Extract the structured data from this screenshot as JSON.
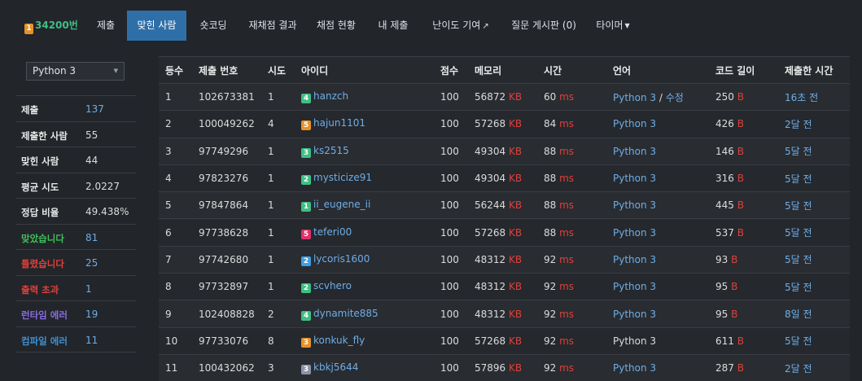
{
  "nav": {
    "problem_id": "34200번",
    "tabs": [
      "제출",
      "맞힌 사람",
      "숏코딩",
      "재채점 결과",
      "채점 현황",
      "내 제출",
      "난이도 기여",
      "질문 게시판 (0)",
      "타이머"
    ]
  },
  "sidebar": {
    "language": "Python 3",
    "stats": [
      {
        "label": "제출",
        "value": "137",
        "color": "#e8e8e8",
        "vcolor": "#6eaee8"
      },
      {
        "label": "제출한 사람",
        "value": "55",
        "color": "#e8e8e8",
        "vcolor": "#dcdcdc"
      },
      {
        "label": "맞힌 사람",
        "value": "44",
        "color": "#e8e8e8",
        "vcolor": "#dcdcdc"
      },
      {
        "label": "평균 시도",
        "value": "2.0227",
        "color": "#e8e8e8",
        "vcolor": "#dcdcdc"
      },
      {
        "label": "정답 비율",
        "value": "49.438%",
        "color": "#e8e8e8",
        "vcolor": "#dcdcdc"
      },
      {
        "label": "맞았습니다",
        "value": "81",
        "color": "#3fbf5c",
        "vcolor": "#6eaee8"
      },
      {
        "label": "틀렸습니다",
        "value": "25",
        "color": "#e0403a",
        "vcolor": "#6eaee8"
      },
      {
        "label": "출력 초과",
        "value": "1",
        "color": "#e0403a",
        "vcolor": "#6eaee8"
      },
      {
        "label": "런타임 에러",
        "value": "19",
        "color": "#8a6ce0",
        "vcolor": "#6eaee8"
      },
      {
        "label": "컴파일 에러",
        "value": "11",
        "color": "#3f8fd0",
        "vcolor": "#6eaee8"
      }
    ]
  },
  "table": {
    "headers": [
      "등수",
      "제출 번호",
      "시도",
      "아이디",
      "점수",
      "메모리",
      "시간",
      "언어",
      "코드 길이",
      "제출한 시간"
    ],
    "rows": [
      {
        "rank": "1",
        "sub": "102673381",
        "tries": "1",
        "tier": "4",
        "tcolor": "#3fbf84",
        "user": "hanzch",
        "score": "100",
        "mem": "56872",
        "mem_unit": "KB",
        "time": "60",
        "time_unit": "ms",
        "lang": "Python 3",
        "edit": "수정",
        "len": "250",
        "len_unit": "B",
        "when": "16초 전",
        "lang_link": true
      },
      {
        "rank": "2",
        "sub": "100049262",
        "tries": "4",
        "tier": "5",
        "tcolor": "#e8922a",
        "user": "hajun1101",
        "score": "100",
        "mem": "57268",
        "mem_unit": "KB",
        "time": "84",
        "time_unit": "ms",
        "lang": "Python 3",
        "edit": "",
        "len": "426",
        "len_unit": "B",
        "when": "2달 전",
        "lang_link": true
      },
      {
        "rank": "3",
        "sub": "97749296",
        "tries": "1",
        "tier": "3",
        "tcolor": "#3fbf84",
        "user": "ks2515",
        "score": "100",
        "mem": "49304",
        "mem_unit": "KB",
        "time": "88",
        "time_unit": "ms",
        "lang": "Python 3",
        "edit": "",
        "len": "146",
        "len_unit": "B",
        "when": "5달 전",
        "lang_link": true
      },
      {
        "rank": "4",
        "sub": "97823276",
        "tries": "1",
        "tier": "2",
        "tcolor": "#3fbf84",
        "user": "mysticize91",
        "score": "100",
        "mem": "49304",
        "mem_unit": "KB",
        "time": "88",
        "time_unit": "ms",
        "lang": "Python 3",
        "edit": "",
        "len": "316",
        "len_unit": "B",
        "when": "5달 전",
        "lang_link": true
      },
      {
        "rank": "5",
        "sub": "97847864",
        "tries": "1",
        "tier": "1",
        "tcolor": "#3fbf84",
        "user": "ii_eugene_ii",
        "score": "100",
        "mem": "56244",
        "mem_unit": "KB",
        "time": "88",
        "time_unit": "ms",
        "lang": "Python 3",
        "edit": "",
        "len": "445",
        "len_unit": "B",
        "when": "5달 전",
        "lang_link": true
      },
      {
        "rank": "6",
        "sub": "97738628",
        "tries": "1",
        "tier": "5",
        "tcolor": "#e0306a",
        "user": "teferi00",
        "score": "100",
        "mem": "57268",
        "mem_unit": "KB",
        "time": "88",
        "time_unit": "ms",
        "lang": "Python 3",
        "edit": "",
        "len": "537",
        "len_unit": "B",
        "when": "5달 전",
        "lang_link": true
      },
      {
        "rank": "7",
        "sub": "97742680",
        "tries": "1",
        "tier": "2",
        "tcolor": "#3f9fe0",
        "user": "lycoris1600",
        "score": "100",
        "mem": "48312",
        "mem_unit": "KB",
        "time": "92",
        "time_unit": "ms",
        "lang": "Python 3",
        "edit": "",
        "len": "93",
        "len_unit": "B",
        "when": "5달 전",
        "lang_link": true
      },
      {
        "rank": "8",
        "sub": "97732897",
        "tries": "1",
        "tier": "2",
        "tcolor": "#3fbf84",
        "user": "scvhero",
        "score": "100",
        "mem": "48312",
        "mem_unit": "KB",
        "time": "92",
        "time_unit": "ms",
        "lang": "Python 3",
        "edit": "",
        "len": "95",
        "len_unit": "B",
        "when": "5달 전",
        "lang_link": true
      },
      {
        "rank": "9",
        "sub": "102408828",
        "tries": "2",
        "tier": "4",
        "tcolor": "#3fbf84",
        "user": "dynamite885",
        "score": "100",
        "mem": "48312",
        "mem_unit": "KB",
        "time": "92",
        "time_unit": "ms",
        "lang": "Python 3",
        "edit": "",
        "len": "95",
        "len_unit": "B",
        "when": "8일 전",
        "lang_link": true
      },
      {
        "rank": "10",
        "sub": "97733076",
        "tries": "8",
        "tier": "3",
        "tcolor": "#e8922a",
        "user": "konkuk_fly",
        "score": "100",
        "mem": "57268",
        "mem_unit": "KB",
        "time": "92",
        "time_unit": "ms",
        "lang": "Python 3",
        "edit": "",
        "len": "611",
        "len_unit": "B",
        "when": "5달 전",
        "lang_link": false
      },
      {
        "rank": "11",
        "sub": "100432062",
        "tries": "3",
        "tier": "3",
        "tcolor": "#8a93a8",
        "user": "kbkj5644",
        "score": "100",
        "mem": "57896",
        "mem_unit": "KB",
        "time": "92",
        "time_unit": "ms",
        "lang": "Python 3",
        "edit": "",
        "len": "287",
        "len_unit": "B",
        "when": "2달 전",
        "lang_link": true
      }
    ]
  }
}
